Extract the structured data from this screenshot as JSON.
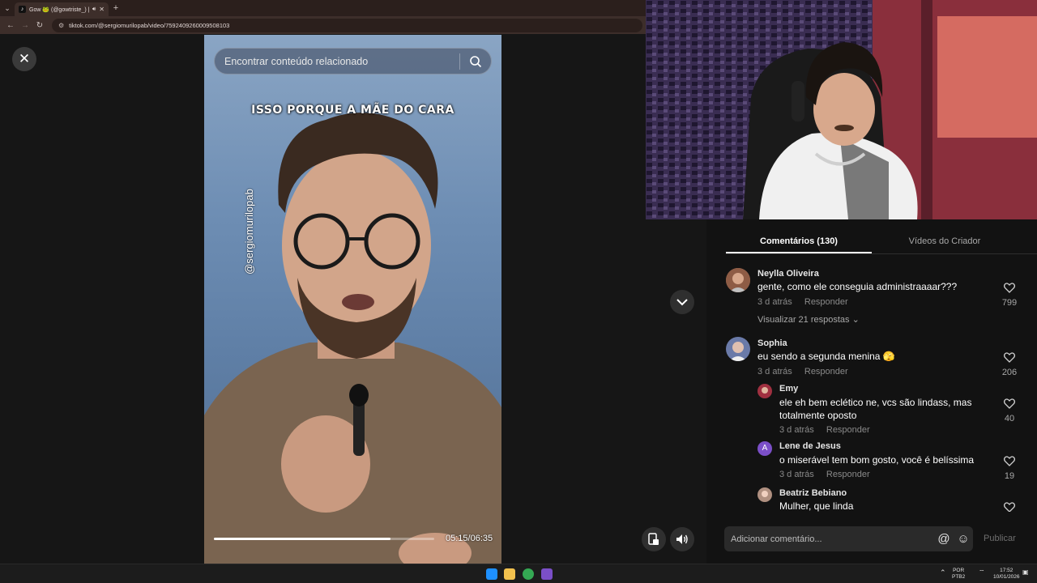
{
  "browser": {
    "tab_title": "Gow 🐸 (@gowtriste_) | Ti",
    "url": "tiktok.com/@sergiomurilopab/video/7592409260009508103"
  },
  "video": {
    "search_placeholder": "Encontrar conteúdo relacionado",
    "caption": "ISSO PORQUE A MÃE DO CARA",
    "handle": "@sergiomurilopab",
    "timecode": "05:15/06:35",
    "progress": 0.8
  },
  "comments_panel": {
    "tabs": [
      {
        "label": "Comentários (130)",
        "active": true
      },
      {
        "label": "Vídeos do Criador",
        "active": false
      }
    ],
    "comments": [
      {
        "name": "Neylla Oliveira",
        "text": "gente, como ele conseguia administraaaar???",
        "time": "3 d atrás",
        "reply": "Responder",
        "likes": "799",
        "view_replies": "Visualizar 21 respostas"
      },
      {
        "name": "Sophia",
        "text": "eu sendo a segunda menina 🫣",
        "time": "3 d atrás",
        "reply": "Responder",
        "likes": "206"
      }
    ],
    "replies": [
      {
        "name": "Emy",
        "text": "ele eh bem eclético ne, vcs são lindass, mas totalmente oposto",
        "time": "3 d atrás",
        "reply": "Responder",
        "likes": "40"
      },
      {
        "name": "Lene de Jesus",
        "initial": "A",
        "text": "o miserável tem bom gosto, você é belíssima",
        "time": "3 d atrás",
        "reply": "Responder",
        "likes": "19"
      },
      {
        "name": "Beatriz Bebiano",
        "text": "Mulher, que linda"
      }
    ],
    "comment_placeholder": "Adicionar comentário...",
    "publish_label": "Publicar"
  },
  "taskbar": {
    "lang_top": "POR",
    "lang_bottom": "PTB2",
    "time": "17:52",
    "date": "10/01/2026"
  },
  "icons": [
    "close-icon",
    "search-icon",
    "chevron-down-icon",
    "heart-icon",
    "at-icon",
    "emoji-icon",
    "volume-icon",
    "pip-icon"
  ]
}
